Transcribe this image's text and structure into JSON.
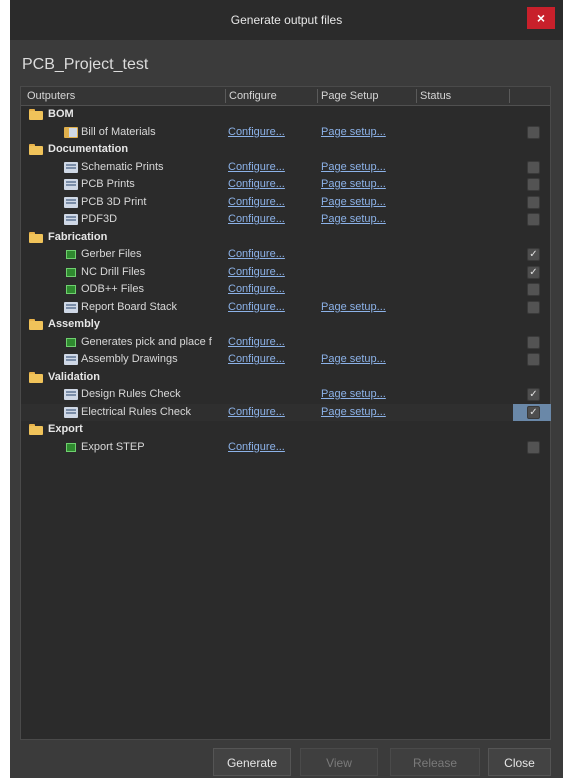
{
  "window": {
    "title": "Generate output files",
    "close_label": "×"
  },
  "project_name": "PCB_Project_test",
  "columns": {
    "outputers": "Outputers",
    "configure": "Configure",
    "page_setup": "Page Setup",
    "status": "Status"
  },
  "rows": [
    {
      "type": "group",
      "name": "BOM"
    },
    {
      "type": "item",
      "icon": "bom-icon",
      "name": "Bill of Materials",
      "configure": "Configure...",
      "page_setup": "Page setup...",
      "checked": false
    },
    {
      "type": "group",
      "name": "Documentation"
    },
    {
      "type": "item",
      "icon": "print-icon",
      "name": "Schematic Prints",
      "configure": "Configure...",
      "page_setup": "Page setup...",
      "checked": false
    },
    {
      "type": "item",
      "icon": "print-icon",
      "name": "PCB Prints",
      "configure": "Configure...",
      "page_setup": "Page setup...",
      "checked": false
    },
    {
      "type": "item",
      "icon": "print-icon",
      "name": "PCB 3D Print",
      "configure": "Configure...",
      "page_setup": "Page setup...",
      "checked": false
    },
    {
      "type": "item",
      "icon": "print-icon",
      "name": "PDF3D",
      "configure": "Configure...",
      "page_setup": "Page setup...",
      "checked": false
    },
    {
      "type": "group",
      "name": "Fabrication"
    },
    {
      "type": "item",
      "icon": "fabrication-icon",
      "name": "Gerber Files",
      "configure": "Configure...",
      "page_setup": "",
      "checked": true
    },
    {
      "type": "item",
      "icon": "fabrication-icon",
      "name": "NC Drill Files",
      "configure": "Configure...",
      "page_setup": "",
      "checked": true
    },
    {
      "type": "item",
      "icon": "fabrication-icon",
      "name": "ODB++ Files",
      "configure": "Configure...",
      "page_setup": "",
      "checked": false
    },
    {
      "type": "item",
      "icon": "print-icon",
      "name": "Report Board Stack",
      "configure": "Configure...",
      "page_setup": "Page setup...",
      "checked": false
    },
    {
      "type": "group",
      "name": "Assembly"
    },
    {
      "type": "item",
      "icon": "fabrication-icon",
      "name": "Generates pick and place f",
      "configure": "Configure...",
      "page_setup": "",
      "checked": false
    },
    {
      "type": "item",
      "icon": "print-icon",
      "name": "Assembly Drawings",
      "configure": "Configure...",
      "page_setup": "Page setup...",
      "checked": false
    },
    {
      "type": "group",
      "name": "Validation"
    },
    {
      "type": "item",
      "icon": "print-icon",
      "name": "Design Rules Check",
      "configure": "",
      "page_setup": "Page setup...",
      "checked": true
    },
    {
      "type": "item",
      "icon": "print-icon",
      "name": "Electrical Rules Check",
      "configure": "Configure...",
      "page_setup": "Page setup...",
      "checked": true,
      "selected": true
    },
    {
      "type": "group",
      "name": "Export"
    },
    {
      "type": "item",
      "icon": "fabrication-icon",
      "name": "Export STEP",
      "configure": "Configure...",
      "page_setup": "",
      "checked": false
    }
  ],
  "buttons": {
    "generate": "Generate",
    "view": "View",
    "release": "Release",
    "close": "Close"
  },
  "colors": {
    "link": "#8cb2e8",
    "close_red": "#c8202b",
    "selection": "#6a88a8"
  }
}
